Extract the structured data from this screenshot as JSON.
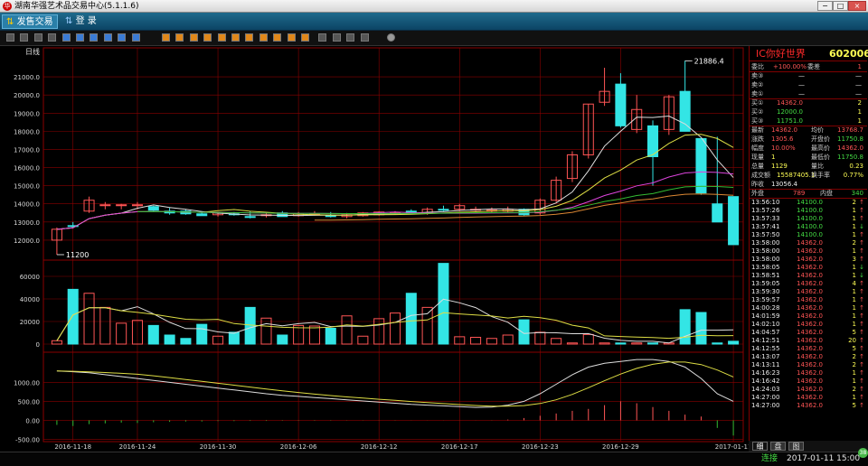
{
  "window": {
    "title": "湖南华强艺术品交易中心(5.1.1.6)",
    "logo_char": "华",
    "minimize": "−",
    "maximize": "□",
    "close": "×"
  },
  "menu": {
    "items": [
      {
        "label": "发售交易",
        "icon": "trade-icon",
        "active": true
      },
      {
        "label": "登  录",
        "icon": "login-icon",
        "active": false
      }
    ]
  },
  "toolbar": {
    "icons": [
      "bar-chart-icon",
      "line-chart-icon",
      "kline-icon",
      "calendar-icon",
      "zoom-box-icon",
      "grid-icon",
      "window-icon",
      "window-icon",
      "window-icon",
      "close-box-icon",
      "orange-icon",
      "orange-icon",
      "orange-icon",
      "orange-icon",
      "orange-icon",
      "orange-icon",
      "orange-icon",
      "orange-icon",
      "orange-icon",
      "orange-icon",
      "orange-icon",
      "notes-icon",
      "zoom-in-icon",
      "zoom-out-icon",
      "draw-icon",
      "settings-icon"
    ]
  },
  "chart": {
    "period_label": "日线",
    "colors": {
      "up": "#ff5555",
      "down": "#33e5e5",
      "ma5": "#dddddd",
      "ma10": "#dddd44",
      "ma20": "#dd44dd",
      "ma30": "#33bb33",
      "ma60": "#dd8833",
      "grid": "#8a0000"
    },
    "price": {
      "ylim": [
        11000,
        22100
      ],
      "ticks": [
        "21000.0",
        "20000.0",
        "19000.0",
        "18000.0",
        "17000.0",
        "16000.0",
        "15000.0",
        "14000.0",
        "13000.0",
        "12000.0"
      ],
      "high_label": "21886.4",
      "low_label": "11200"
    },
    "volume": {
      "ylim": [
        0,
        72000
      ],
      "ticks": [
        "60000",
        "40000",
        "20000",
        "0"
      ]
    },
    "indicator": {
      "ylim": [
        -560,
        1650
      ],
      "ticks": [
        "1000.00",
        "500.00",
        "0.00",
        "-500.00"
      ]
    },
    "dates": [
      "2016-11-18",
      "2016-11-24",
      "2016-11-30",
      "2016-12-06",
      "2016-12-12",
      "2016-12-17",
      "2016-12-23",
      "2016-12-29",
      "2017-01-11"
    ],
    "date_index": [
      1,
      5,
      10,
      15,
      20,
      25,
      30,
      35,
      42
    ],
    "candles": [
      [
        12000,
        12700,
        11200,
        12600
      ],
      [
        12800,
        13000,
        12700,
        12750
      ],
      [
        13600,
        14400,
        13500,
        14200
      ],
      [
        13900,
        14100,
        13700,
        13950
      ],
      [
        13900,
        14000,
        13700,
        13950
      ],
      [
        13900,
        14100,
        13700,
        13950
      ],
      [
        13850,
        13900,
        13600,
        13650
      ],
      [
        13600,
        13800,
        13400,
        13500
      ],
      [
        13600,
        13700,
        13400,
        13450
      ],
      [
        13450,
        13600,
        13350,
        13350
      ],
      [
        13400,
        13550,
        13300,
        13500
      ],
      [
        13450,
        13550,
        13350,
        13400
      ],
      [
        13300,
        13600,
        13200,
        13250
      ],
      [
        13350,
        13500,
        13250,
        13400
      ],
      [
        13500,
        13600,
        13300,
        13300
      ],
      [
        13350,
        13550,
        13300,
        13450
      ],
      [
        13400,
        13600,
        13350,
        13450
      ],
      [
        13350,
        13550,
        13250,
        13300
      ],
      [
        13300,
        13500,
        13200,
        13400
      ],
      [
        13350,
        13550,
        13300,
        13500
      ],
      [
        13400,
        13600,
        13350,
        13550
      ],
      [
        13450,
        13600,
        13400,
        13500
      ],
      [
        13600,
        13700,
        13450,
        13450
      ],
      [
        13500,
        13800,
        13400,
        13700
      ],
      [
        13700,
        13900,
        13600,
        13650
      ],
      [
        13700,
        14000,
        13600,
        13900
      ],
      [
        13700,
        13850,
        13600,
        13700
      ],
      [
        13600,
        13800,
        13500,
        13650
      ],
      [
        13600,
        13850,
        13500,
        13700
      ],
      [
        13700,
        13750,
        13350,
        13400
      ],
      [
        13500,
        14300,
        13400,
        14200
      ],
      [
        14200,
        15500,
        14100,
        15300
      ],
      [
        15400,
        16900,
        15200,
        16700
      ],
      [
        16700,
        19500,
        16500,
        19500
      ],
      [
        19600,
        21500,
        19400,
        20200
      ],
      [
        20600,
        21200,
        18200,
        18300
      ],
      [
        18100,
        20000,
        17900,
        19200
      ],
      [
        18300,
        18600,
        15000,
        16600
      ],
      [
        18100,
        20000,
        17800,
        19900
      ],
      [
        20200,
        21886,
        18000,
        18000
      ],
      [
        17600,
        17600,
        14500,
        14600
      ],
      [
        14000,
        17700,
        13000,
        13000
      ],
      [
        14400,
        14400,
        11750,
        11750
      ]
    ],
    "volumes": [
      3000,
      48500,
      45000,
      32500,
      18500,
      21000,
      16500,
      8000,
      5000,
      17500,
      7000,
      10500,
      32500,
      23000,
      8000,
      16500,
      16000,
      14000,
      25000,
      7000,
      22500,
      27500,
      45000,
      32500,
      71500,
      6500,
      6000,
      5000,
      8000,
      21500,
      10500,
      5000,
      1000,
      8500,
      1000,
      1000,
      1000,
      1000,
      1000,
      30500,
      28000,
      1000,
      2500,
      1500
    ],
    "osc": [
      1300,
      1280,
      1250,
      1200,
      1150,
      1100,
      1050,
      1000,
      950,
      900,
      850,
      800,
      750,
      700,
      660,
      630,
      600,
      570,
      540,
      510,
      480,
      450,
      420,
      400,
      380,
      360,
      340,
      350,
      400,
      500,
      700,
      950,
      1200,
      1400,
      1500,
      1550,
      1600,
      1600,
      1550,
      1400,
      1100,
      700,
      500,
      300
    ],
    "hist": [
      -120,
      -150,
      -100,
      -80,
      -60,
      -70,
      -50,
      -40,
      -30,
      -30,
      -20,
      -20,
      -15,
      -15,
      -10,
      -10,
      -10,
      -8,
      -5,
      -5,
      -5,
      -5,
      -3,
      -3,
      -3,
      -3,
      -3,
      -5,
      20,
      60,
      120,
      180,
      250,
      300,
      400,
      500,
      450,
      350,
      250,
      150,
      100,
      -200,
      -400,
      -550
    ]
  },
  "quote": {
    "name": "IC你好世界",
    "code": "602006",
    "order_rows": [
      {
        "label": "委比",
        "mid": "+100.00%",
        "label2": "委差",
        "val": "1"
      },
      {
        "label": "卖③",
        "mid": "—",
        "val": "—"
      },
      {
        "label": "卖②",
        "mid": "—",
        "val": "—"
      },
      {
        "label": "卖①",
        "mid": "—",
        "val": "—"
      },
      {
        "label": "买①",
        "mid": "14362.0",
        "val": "2"
      },
      {
        "label": "买②",
        "mid": "12000.0",
        "val": "1"
      },
      {
        "label": "买③",
        "mid": "11751.0",
        "val": "1"
      }
    ],
    "stats": [
      {
        "l1": "最新",
        "v1": "14362.0",
        "l2": "均价",
        "v2": "13768.7"
      },
      {
        "l1": "涨跌",
        "v1": "1305.6",
        "l2": "开盘价",
        "v2": "11750.8"
      },
      {
        "l1": "幅度",
        "v1": "10.00%",
        "l2": "最高价",
        "v2": "14362.0"
      },
      {
        "l1": "现量",
        "v1": "1",
        "l2": "最低价",
        "v2": "11750.8"
      },
      {
        "l1": "总量",
        "v1": "1129",
        "l2": "量比",
        "v2": "0.23"
      },
      {
        "l1": "成交额",
        "v1": "15587405.1",
        "l2": "换手率",
        "v2": "0.77%"
      },
      {
        "l1": "昨收",
        "v1": "13056.4",
        "l2": "",
        "v2": ""
      }
    ],
    "outer": {
      "label": "外盘",
      "val": "789",
      "label2": "内盘",
      "val2": "340"
    },
    "ticks": [
      [
        "13:56:10",
        "14100.0",
        "2",
        "↑"
      ],
      [
        "13:57:26",
        "14100.0",
        "1",
        "↑"
      ],
      [
        "13:57:33",
        "14100.0",
        "1",
        "↑"
      ],
      [
        "13:57:41",
        "14100.0",
        "1",
        "↓"
      ],
      [
        "13:57:50",
        "14100.0",
        "1",
        "↑"
      ],
      [
        "13:58:00",
        "14362.0",
        "2",
        "↑"
      ],
      [
        "13:58:00",
        "14362.0",
        "1",
        "↑"
      ],
      [
        "13:58:00",
        "14362.0",
        "3",
        "↑"
      ],
      [
        "13:58:05",
        "14362.0",
        "1",
        "↓"
      ],
      [
        "13:58:51",
        "14362.0",
        "1",
        "↓"
      ],
      [
        "13:59:05",
        "14362.0",
        "4",
        "↑"
      ],
      [
        "13:59:30",
        "14362.0",
        "1",
        "↑"
      ],
      [
        "13:59:57",
        "14362.0",
        "1",
        "↑"
      ],
      [
        "14:00:28",
        "14362.0",
        "1",
        "↑"
      ],
      [
        "14:01:59",
        "14362.0",
        "1",
        "↑"
      ],
      [
        "14:02:10",
        "14362.0",
        "1",
        "↑"
      ],
      [
        "14:04:57",
        "14362.0",
        "5",
        "↑"
      ],
      [
        "14:12:51",
        "14362.0",
        "20",
        "↑"
      ],
      [
        "14:12:55",
        "14362.0",
        "5",
        "↑"
      ],
      [
        "14:13:07",
        "14362.0",
        "2",
        "↑"
      ],
      [
        "14:13:11",
        "14362.0",
        "2",
        "↑"
      ],
      [
        "14:16:23",
        "14362.0",
        "1",
        "↑"
      ],
      [
        "14:16:42",
        "14362.0",
        "1",
        "↑"
      ],
      [
        "14:24:03",
        "14362.0",
        "2",
        "↑"
      ],
      [
        "14:27:00",
        "14362.0",
        "1",
        "↑"
      ],
      [
        "14:27:00",
        "14362.0",
        "5",
        "↑"
      ]
    ]
  },
  "bottom_tabs": [
    "细",
    "盘",
    "图"
  ],
  "status": {
    "link": "连接",
    "time": "2017-01-11  15:00"
  },
  "badge": "38"
}
